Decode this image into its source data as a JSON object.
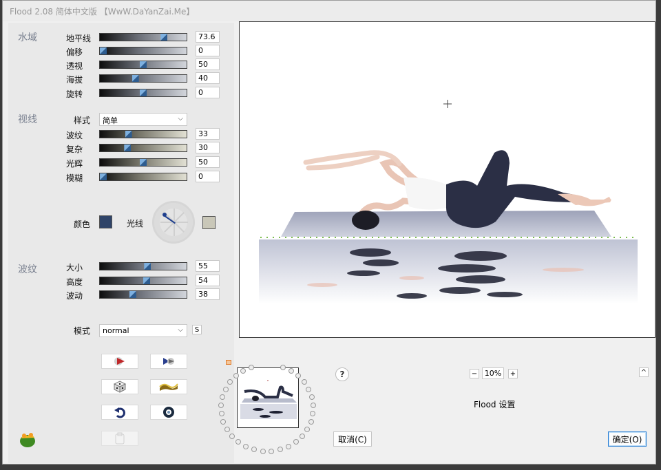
{
  "window": {
    "title": "Flood 2.08 简体中文版 【WwW.DaYanZai.Me】"
  },
  "sections": {
    "water": "水域",
    "view": "视线",
    "waves": "波纹"
  },
  "water": [
    {
      "label": "地平线",
      "value": "73.6",
      "fraction": 0.74
    },
    {
      "label": "偏移",
      "value": "0",
      "fraction": 0.04
    },
    {
      "label": "透视",
      "value": "50",
      "fraction": 0.5
    },
    {
      "label": "海拔",
      "value": "40",
      "fraction": 0.41
    },
    {
      "label": "旋转",
      "value": "0",
      "fraction": 0.5
    }
  ],
  "view": {
    "style_label": "样式",
    "style_value": "简单",
    "sliders": [
      {
        "label": "波纹",
        "value": "33",
        "fraction": 0.33
      },
      {
        "label": "复杂",
        "value": "30",
        "fraction": 0.32
      },
      {
        "label": "光辉",
        "value": "50",
        "fraction": 0.5
      },
      {
        "label": "模糊",
        "value": "0",
        "fraction": 0.04
      }
    ],
    "color_label": "颜色",
    "color": "#2f4468",
    "light_label": "光线",
    "light_color": "#c9c7b8"
  },
  "waves": [
    {
      "label": "大小",
      "value": "55",
      "fraction": 0.55
    },
    {
      "label": "高度",
      "value": "54",
      "fraction": 0.54
    },
    {
      "label": "波动",
      "value": "38",
      "fraction": 0.38
    }
  ],
  "mode": {
    "label": "模式",
    "value": "normal",
    "s_label": "S"
  },
  "tool_buttons": [
    {
      "name": "play-button",
      "icon": "play-icon"
    },
    {
      "name": "forward-button",
      "icon": "forward-icon"
    },
    {
      "name": "random-button",
      "icon": "dice-icon"
    },
    {
      "name": "wave-button",
      "icon": "wave-icon"
    },
    {
      "name": "undo-button",
      "icon": "undo-icon"
    },
    {
      "name": "loop-button",
      "icon": "loop-icon"
    },
    {
      "name": "clipboard-button",
      "icon": "clipboard-icon"
    }
  ],
  "help": "?",
  "zoom": {
    "minus": "−",
    "value": "10%",
    "plus": "+"
  },
  "collapse": "^",
  "settings_label": "Flood 设置",
  "cancel_label": "取消(C)",
  "ok_label": "确定(O)"
}
